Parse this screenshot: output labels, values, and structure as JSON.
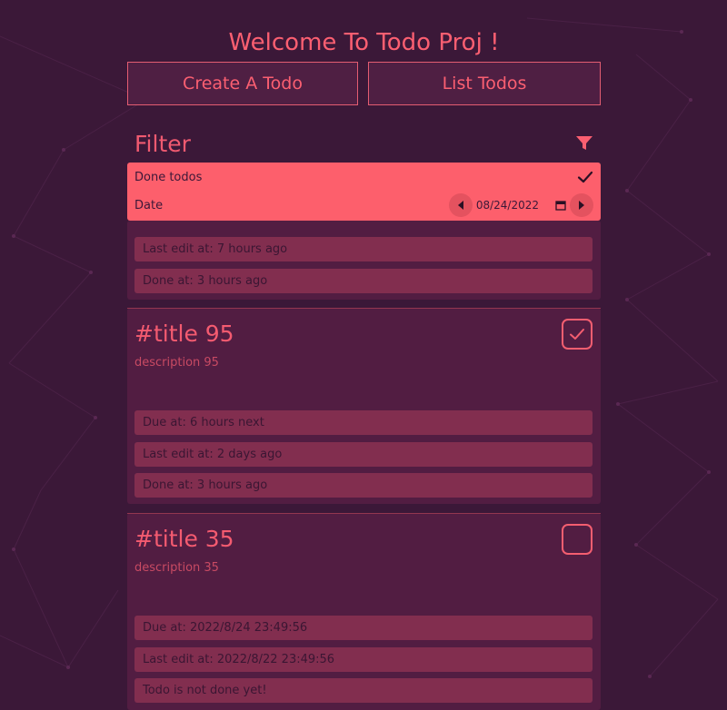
{
  "header": {
    "title": "Welcome To Todo Proj !",
    "create_label": "Create A Todo",
    "list_label": "List Todos"
  },
  "filter": {
    "label": "Filter",
    "done_label": "Done todos",
    "done_checked": true,
    "date_label": "Date",
    "date_value": "08/24/2022"
  },
  "todos": [
    {
      "title": "",
      "description": "",
      "done": true,
      "last_edit": "Last edit at: 7 hours ago",
      "status": "Done at: 3 hours ago"
    },
    {
      "title": "#title 95",
      "description": "description 95",
      "done": true,
      "due": "Due at: 6 hours next",
      "last_edit": "Last edit at: 2 days ago",
      "status": "Done at: 3 hours ago"
    },
    {
      "title": "#title 35",
      "description": "description 35",
      "done": false,
      "due": "Due at: 2022/8/24 23:49:56",
      "last_edit": "Last edit at: 2022/8/22 23:49:56",
      "status": "Todo is not done yet!"
    }
  ],
  "colors": {
    "background": "#3b1838",
    "accent": "#fd5f6c",
    "card": "#521d42",
    "info_box": "#822e4f"
  }
}
